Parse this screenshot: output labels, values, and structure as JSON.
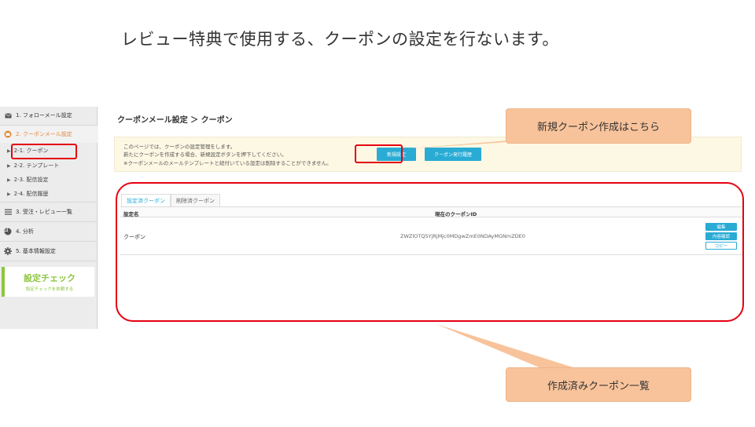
{
  "slide": {
    "title": "レビュー特典で使用する、クーポンの設定を行ないます。"
  },
  "sidebar": {
    "items": [
      {
        "label": "1. フォローメール設定",
        "icon": "mail-icon"
      },
      {
        "label": "2. クーポンメール設定",
        "icon": "coupon-icon"
      },
      {
        "label": "3. 受注・レビュー一覧",
        "icon": "list-icon"
      },
      {
        "label": "4. 分析",
        "icon": "pie-chart-icon"
      },
      {
        "label": "5. 基本情報設定",
        "icon": "gear-icon"
      }
    ],
    "subitems": [
      {
        "label": "2-1. クーポン"
      },
      {
        "label": "2-2. テンプレート"
      },
      {
        "label": "2-3. 配信設定"
      },
      {
        "label": "2-4. 配信履歴"
      }
    ],
    "check": {
      "title": "設定チェック",
      "subtitle": "設定チェックを依頼する"
    }
  },
  "main": {
    "breadcrumb": "クーポンメール設定 ＞ クーポン",
    "notice": {
      "lines": [
        "このページでは、クーポンの設定管理をします。",
        "新たにクーポンを作成する場合、新規設定ボタンを押下してください。",
        "※クーポンメールのメールテンプレートと紐付いている設定は削除することができません。"
      ],
      "new_button": "新規設定",
      "history_button": "クーポン発行履歴"
    },
    "tabs": [
      {
        "label": "設定済クーポン"
      },
      {
        "label": "削除済クーポン"
      }
    ],
    "table": {
      "headers": [
        "設定名",
        "現在のクーポンID"
      ],
      "rows": [
        {
          "name": "クーポン",
          "coupon_id": "ZWZlOTQ5YjRjMjc0MDgwZmE0NDAyMGNmZDE0",
          "actions": [
            "編集",
            "内容確認",
            "コピー"
          ]
        }
      ]
    }
  },
  "annotations": {
    "new_coupon_callout": "新規クーポン作成はこちら",
    "created_list_callout": "作成済みクーポン一覧"
  },
  "colors": {
    "accent": "#29abd4",
    "highlight": "#e60012",
    "callout": "#f8c39b",
    "check": "#8cc63f",
    "active_menu": "#e08a3c"
  }
}
